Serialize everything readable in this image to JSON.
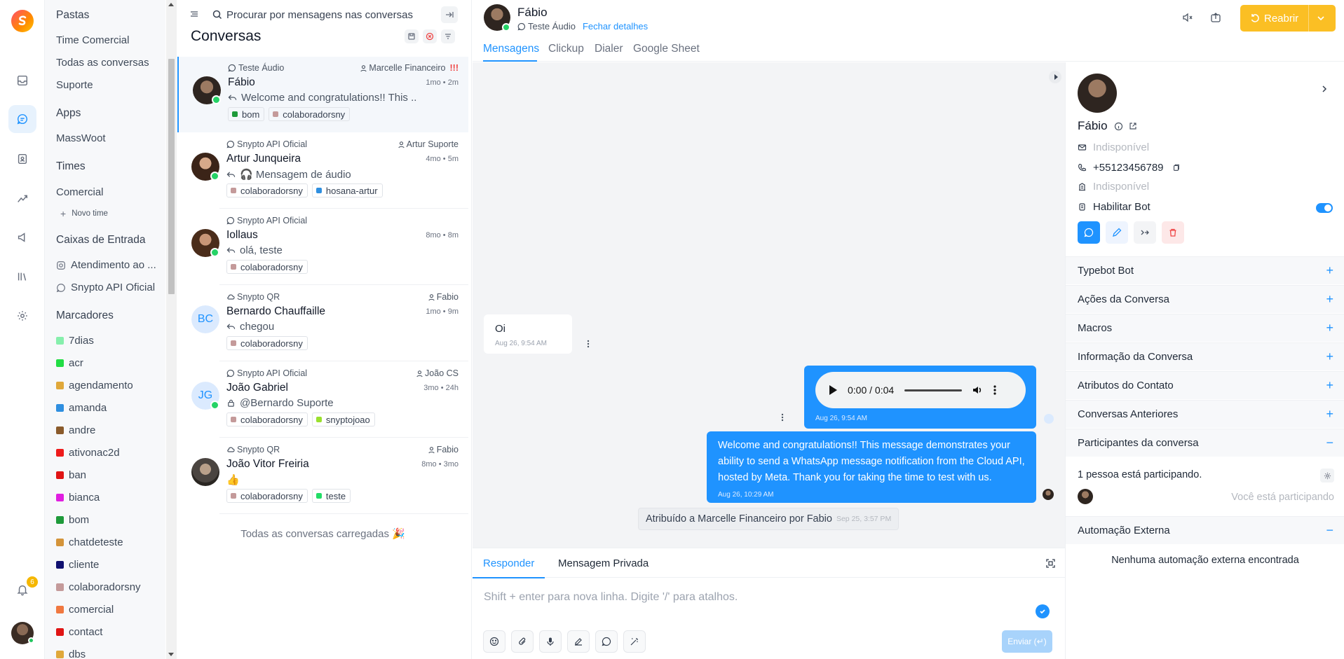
{
  "sidebar": {
    "folders_title": "Pastas",
    "folders": [
      "Time Comercial",
      "Todas as conversas",
      "Suporte"
    ],
    "apps_title": "Apps",
    "apps": [
      "MassWoot"
    ],
    "teams_title": "Times",
    "teams": [
      "Comercial"
    ],
    "new_team": "Novo time",
    "inboxes_title": "Caixas de Entrada",
    "inboxes": [
      "Atendimento ao ...",
      "Snypto API Oficial"
    ],
    "labels_title": "Marcadores",
    "labels": [
      {
        "name": "7dias",
        "color": "#86efac"
      },
      {
        "name": "acr",
        "color": "#22dd44"
      },
      {
        "name": "agendamento",
        "color": "#e0a83a"
      },
      {
        "name": "amanda",
        "color": "#2f8fe0"
      },
      {
        "name": "andre",
        "color": "#8a5a2b"
      },
      {
        "name": "ativonac2d",
        "color": "#ee1b1b"
      },
      {
        "name": "ban",
        "color": "#e01414"
      },
      {
        "name": "bianca",
        "color": "#e01ee0"
      },
      {
        "name": "bom",
        "color": "#1e9a3a"
      },
      {
        "name": "chatdeteste",
        "color": "#d4943a"
      },
      {
        "name": "cliente",
        "color": "#101070"
      },
      {
        "name": "colaboradorsny",
        "color": "#c49a9a"
      },
      {
        "name": "comercial",
        "color": "#f07840"
      },
      {
        "name": "contact",
        "color": "#e01414"
      },
      {
        "name": "dbs",
        "color": "#e0a83a"
      }
    ]
  },
  "rail": {
    "notification_count": "6"
  },
  "list": {
    "search_placeholder": "Procurar por mensagens nas conversas",
    "title": "Conversas",
    "footer": "Todas as conversas carregadas 🎉",
    "conversations": [
      {
        "inbox": "Teste Áudio",
        "assignee": "Marcelle Financeiro",
        "priority": "!!!",
        "name": "Fábio",
        "time": "1mo • 2m",
        "message": "Welcome and congratulations!! This ...",
        "tags": [
          {
            "name": "bom",
            "color": "#1e9a3a"
          },
          {
            "name": "colaboradorsny",
            "color": "#c49a9a"
          }
        ]
      },
      {
        "inbox": "Snypto API Oficial",
        "assignee": "Artur Suporte",
        "name": "Artur Junqueira",
        "time": "4mo • 5m",
        "message": "🎧 Mensagem de áudio",
        "tags": [
          {
            "name": "colaboradorsny",
            "color": "#c49a9a"
          },
          {
            "name": "hosana-artur",
            "color": "#2f8fe0"
          }
        ]
      },
      {
        "inbox": "Snypto API Oficial",
        "assignee": "",
        "name": "Iollaus",
        "time": "8mo • 8m",
        "message": "olá, teste",
        "tags": [
          {
            "name": "colaboradorsny",
            "color": "#c49a9a"
          }
        ]
      },
      {
        "inbox": "Snypto QR",
        "assignee": "Fabio",
        "name": "Bernardo Chauffaille",
        "initials": "BC",
        "time": "1mo • 9m",
        "message": "chegou",
        "tags": [
          {
            "name": "colaboradorsny",
            "color": "#c49a9a"
          }
        ]
      },
      {
        "inbox": "Snypto API Oficial",
        "assignee": "João CS",
        "name": "João Gabriel",
        "initials": "JG",
        "time": "3mo • 24h",
        "message": "@Bernardo Suporte",
        "tags": [
          {
            "name": "colaboradorsny",
            "color": "#c49a9a"
          },
          {
            "name": "snyptojoao",
            "color": "#9ae02e"
          }
        ]
      },
      {
        "inbox": "Snypto QR",
        "assignee": "Fabio",
        "name": "João Vitor Freiria",
        "time": "8mo • 3mo",
        "message": "👍",
        "tags": [
          {
            "name": "colaboradorsny",
            "color": "#c49a9a"
          },
          {
            "name": "teste",
            "color": "#22dd66"
          }
        ]
      }
    ]
  },
  "chat": {
    "contact_name": "Fábio",
    "inbox": "Teste Áudio",
    "close_details": "Fechar detalhes",
    "reopen": "Reabrir",
    "tabs": [
      "Mensagens",
      "Clickup",
      "Dialer",
      "Google Sheet"
    ],
    "incoming_text": "Oi",
    "incoming_time": "Aug 26, 9:54 AM",
    "audio_time": "0:00 / 0:04",
    "audio_meta": "Aug 26, 9:54 AM",
    "outgoing_text": "Welcome and congratulations!! This message demonstrates your ability to send a WhatsApp message notification from the Cloud API, hosted by Meta. Thank you for taking the time to test with us.",
    "outgoing_time": "Aug 26, 10:29 AM",
    "activity": "Atribuído a Marcelle Financeiro por Fabio",
    "activity_time": "Sep 25, 3:57 PM",
    "reply_tab": "Responder",
    "private_tab": "Mensagem Privada",
    "composer_placeholder": "Shift + enter para nova linha. Digite '/' para atalhos.",
    "send": "Enviar (↵)"
  },
  "contact": {
    "name": "Fábio",
    "email": "Indisponível",
    "phone": "+55123456789",
    "company": "Indisponível",
    "bot_label": "Habilitar Bot",
    "bot_enabled": true,
    "sections": [
      "Typebot Bot",
      "Ações da Conversa",
      "Macros",
      "Informação da Conversa",
      "Atributos do Contato",
      "Conversas Anteriores",
      "Participantes da conversa"
    ],
    "participants_text": "1 pessoa está participando.",
    "you_participating": "Você está participando",
    "external_title": "Automação Externa",
    "external_empty": "Nenhuma automação externa encontrada"
  },
  "colors": {
    "accent": "#1f93ff",
    "reopen": "#fbbf24",
    "danger": "#ef4444"
  }
}
